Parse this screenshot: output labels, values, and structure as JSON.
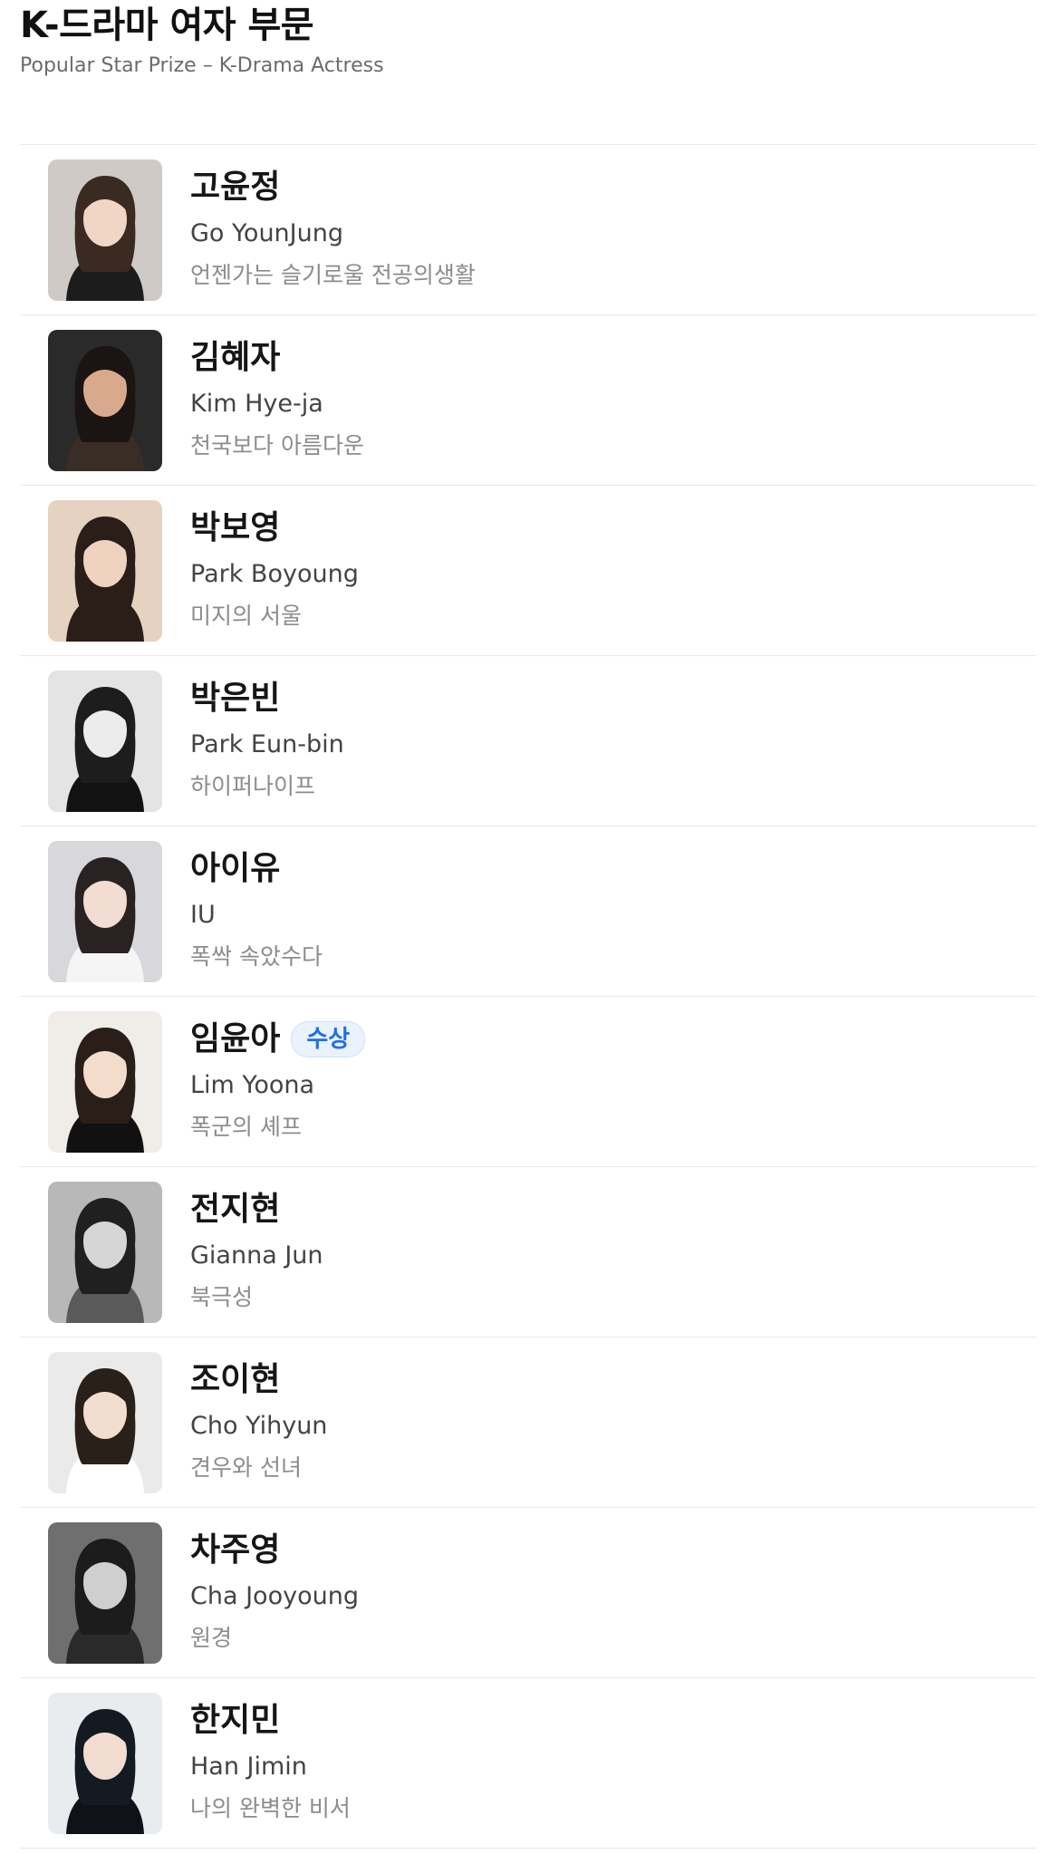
{
  "header": {
    "title": "K-드라마 여자 부문",
    "subtitle": "Popular Star Prize – K-Drama Actress"
  },
  "nominees": [
    {
      "name_ko": "고윤정",
      "name_en": "Go YounJung",
      "drama": "언젠가는 슬기로울 전공의생활",
      "badge": "",
      "photo": {
        "bg": "#cfcac6",
        "hair": "#3a2a22",
        "skin": "#f1d6c6",
        "cloth": "#1c1c1c"
      }
    },
    {
      "name_ko": "김혜자",
      "name_en": "Kim Hye-ja",
      "drama": "천국보다 아름다운",
      "badge": "",
      "photo": {
        "bg": "#2a2a2a",
        "hair": "#1a1512",
        "skin": "#d9a98e",
        "cloth": "#3a2d26"
      }
    },
    {
      "name_ko": "박보영",
      "name_en": "Park Boyoung",
      "drama": "미지의 서울",
      "badge": "",
      "photo": {
        "bg": "#e6d2c0",
        "hair": "#2b1d17",
        "skin": "#f0d2c0",
        "cloth": "#2b1d17"
      }
    },
    {
      "name_ko": "박은빈",
      "name_en": "Park Eun-bin",
      "drama": "하이퍼나이프",
      "badge": "",
      "photo": {
        "bg": "#e4e4e4",
        "hair": "#1d1d1d",
        "skin": "#ececec",
        "cloth": "#121212"
      }
    },
    {
      "name_ko": "아이유",
      "name_en": "IU",
      "drama": "폭싹 속았수다",
      "badge": "",
      "photo": {
        "bg": "#d8d8dc",
        "hair": "#2a2222",
        "skin": "#f3dcd2",
        "cloth": "#f5f5f5"
      }
    },
    {
      "name_ko": "임윤아",
      "name_en": "Lim Yoona",
      "drama": "폭군의 셰프",
      "badge": "수상",
      "photo": {
        "bg": "#f0ece8",
        "hair": "#2a1e18",
        "skin": "#f4dccd",
        "cloth": "#111111"
      }
    },
    {
      "name_ko": "전지현",
      "name_en": "Gianna Jun",
      "drama": "북극성",
      "badge": "",
      "photo": {
        "bg": "#b8b8b8",
        "hair": "#202020",
        "skin": "#d6d6d6",
        "cloth": "#5a5a5a"
      }
    },
    {
      "name_ko": "조이현",
      "name_en": "Cho Yihyun",
      "drama": "견우와 선녀",
      "badge": "",
      "photo": {
        "bg": "#eaeaea",
        "hair": "#2a201a",
        "skin": "#f3ddd0",
        "cloth": "#ffffff"
      }
    },
    {
      "name_ko": "차주영",
      "name_en": "Cha Jooyoung",
      "drama": "원경",
      "badge": "",
      "photo": {
        "bg": "#6f6f6f",
        "hair": "#1c1c1c",
        "skin": "#cfcfcf",
        "cloth": "#2a2a2a"
      }
    },
    {
      "name_ko": "한지민",
      "name_en": "Han Jimin",
      "drama": "나의 완벽한 비서",
      "badge": "",
      "photo": {
        "bg": "#e9ecef",
        "hair": "#141a22",
        "skin": "#f2dcd0",
        "cloth": "#0f1218"
      }
    }
  ]
}
